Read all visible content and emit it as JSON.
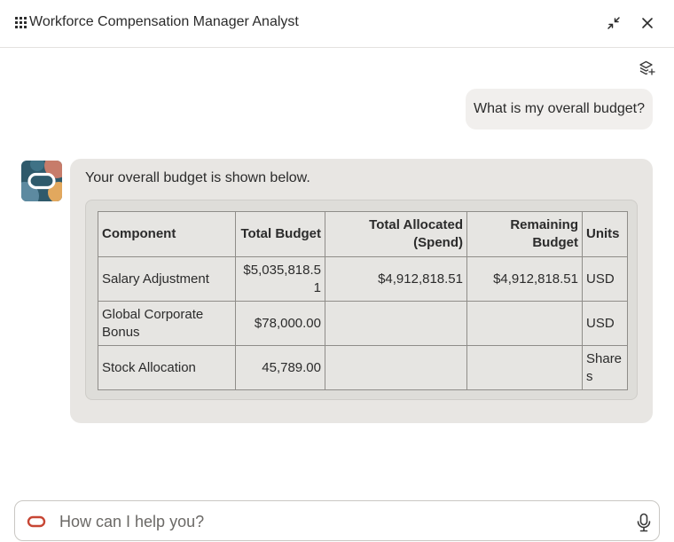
{
  "header": {
    "title": "Workforce Compensation Manager Analyst",
    "menu_icon": "grid-menu-icon",
    "minimize_icon": "minimize-icon",
    "close_icon": "close-icon"
  },
  "toolbar": {
    "layers_icon": "layers-add-icon"
  },
  "conversation": {
    "user_message": "What is my overall budget?",
    "assistant_message": "Your overall budget is shown below.",
    "assistant_avatar": "oracle-avatar",
    "table": {
      "columns": [
        "Component",
        "Total Budget",
        "Total Allocated (Spend)",
        "Remaining Budget",
        "Units"
      ],
      "rows": [
        {
          "component": "Salary Adjustment",
          "total_budget": "$5,035,818.51",
          "total_allocated": "$4,912,818.51",
          "remaining_budget": "$4,912,818.51",
          "units": "USD"
        },
        {
          "component": "Global Corporate Bonus",
          "total_budget": "$78,000.00",
          "total_allocated": "",
          "remaining_budget": "",
          "units": "USD"
        },
        {
          "component": "Stock Allocation",
          "total_budget": "45,789.00",
          "total_allocated": "",
          "remaining_budget": "",
          "units": "Shares"
        }
      ]
    }
  },
  "input": {
    "placeholder": "How can I help you?",
    "value": "",
    "brand_icon": "oracle-logo-icon",
    "mic_icon": "microphone-icon"
  },
  "colors": {
    "brand_red": "#c74634",
    "assistant_bubble": "#e8e6e3",
    "user_bubble": "#f1efed"
  }
}
